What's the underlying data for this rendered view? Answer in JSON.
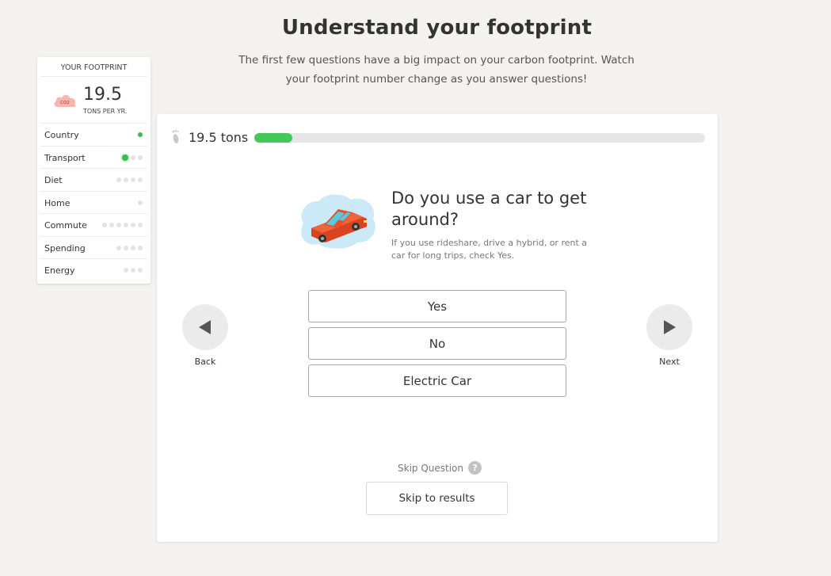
{
  "header": {
    "title": "Understand your footprint",
    "subtitle": "The first few questions have a big impact on your carbon footprint. Watch your footprint number change as you answer questions!"
  },
  "sidebar": {
    "heading": "YOUR FOOTPRINT",
    "total_value": "19.5",
    "total_unit": "TONS PER YR.",
    "co2_badge": "CO2",
    "categories": [
      {
        "label": "Country",
        "steps": 1,
        "completed": 1,
        "current": false
      },
      {
        "label": "Transport",
        "steps": 3,
        "completed": 0,
        "current": true
      },
      {
        "label": "Diet",
        "steps": 4,
        "completed": 0,
        "current": false
      },
      {
        "label": "Home",
        "steps": 1,
        "completed": 0,
        "current": false
      },
      {
        "label": "Commute",
        "steps": 6,
        "completed": 0,
        "current": false
      },
      {
        "label": "Spending",
        "steps": 4,
        "completed": 0,
        "current": false
      },
      {
        "label": "Energy",
        "steps": 3,
        "completed": 0,
        "current": false
      }
    ]
  },
  "progress": {
    "label": "19.5 tons",
    "fraction": 0.085
  },
  "question": {
    "title": "Do you use a car to get around?",
    "help": "If you use rideshare, drive a hybrid, or rent a car for long trips, check Yes.",
    "answers": [
      "Yes",
      "No",
      "Electric Car"
    ]
  },
  "nav": {
    "back_label": "Back",
    "next_label": "Next"
  },
  "skip": {
    "question_label": "Skip Question",
    "help_glyph": "?",
    "results_label": "Skip to results"
  },
  "colors": {
    "accent_green": "#45c85a",
    "car_red": "#e8502a",
    "cloud_blue": "#cbe9f7"
  }
}
